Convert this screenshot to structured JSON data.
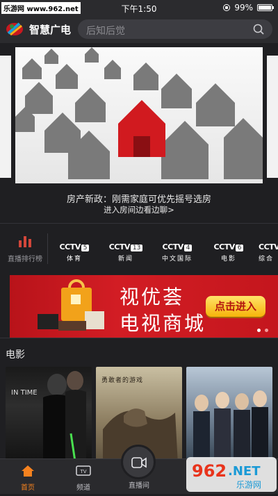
{
  "status": {
    "watermark": "乐游网 www.962.net",
    "time": "下午1:50",
    "battery_percent": 99,
    "battery_text": "99%"
  },
  "header": {
    "app_name": "智慧广电",
    "search_placeholder": "后知后觉"
  },
  "banner": {
    "title": "房产新政：刚需家庭可优先摇号选房",
    "subtitle": "进入房间边看边聊>"
  },
  "channels": {
    "rank_label": "直播排行榜",
    "items": [
      {
        "logo": "CCTV",
        "num": "5",
        "name": "体育"
      },
      {
        "logo": "CCTV",
        "num": "13",
        "name": "新闻"
      },
      {
        "logo": "CCTV",
        "num": "4",
        "name": "中文国际"
      },
      {
        "logo": "CCTV",
        "num": "6",
        "name": "电影"
      },
      {
        "logo": "CCTV",
        "num": "",
        "name": "综合"
      }
    ]
  },
  "ad": {
    "line1": "视优荟",
    "line2": "电视商城",
    "button": "点击进入"
  },
  "movies": {
    "section_title": "电影",
    "posters": [
      {
        "title": "IN TIME"
      },
      {
        "title": "勇敢者的游戏"
      },
      {
        "title": ""
      }
    ]
  },
  "tabbar": {
    "items": [
      {
        "label": "首页",
        "icon": "home-icon",
        "active": true
      },
      {
        "label": "频道",
        "icon": "tv-icon",
        "active": false
      },
      {
        "label": "直播间",
        "icon": "video-camera-icon",
        "active": false
      },
      {
        "label": "",
        "icon": "",
        "active": false
      }
    ]
  },
  "corner_watermark": {
    "text1": "962",
    "text2": ".NET",
    "text3": "乐游网"
  },
  "colors": {
    "accent": "#f5821f",
    "ad_red": "#c4161d",
    "banner_red_house": "#d11a1f"
  }
}
